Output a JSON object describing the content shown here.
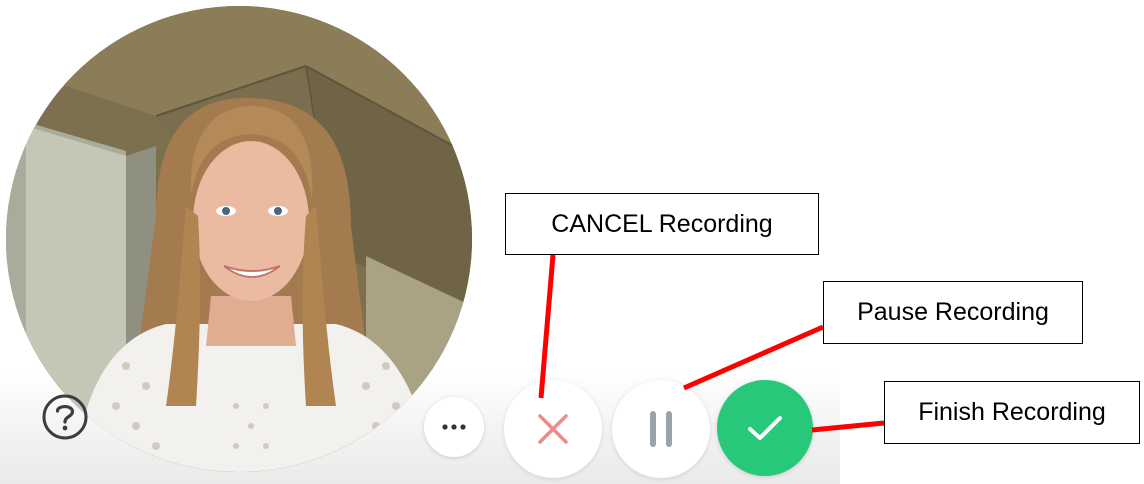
{
  "annotations": {
    "cancel": "CANCEL Recording",
    "pause": "Pause Recording",
    "finish": "Finish Recording"
  },
  "controls": {
    "help_icon": "question-circle-icon",
    "more_icon": "ellipsis-icon",
    "cancel_icon": "close-icon",
    "pause_icon": "pause-icon",
    "finish_icon": "check-icon"
  },
  "colors": {
    "finish_button": "#27c87a",
    "cancel_icon": "#ee8a8a",
    "pause_icon": "#9aa3ad",
    "leader_line": "#ff0000"
  }
}
